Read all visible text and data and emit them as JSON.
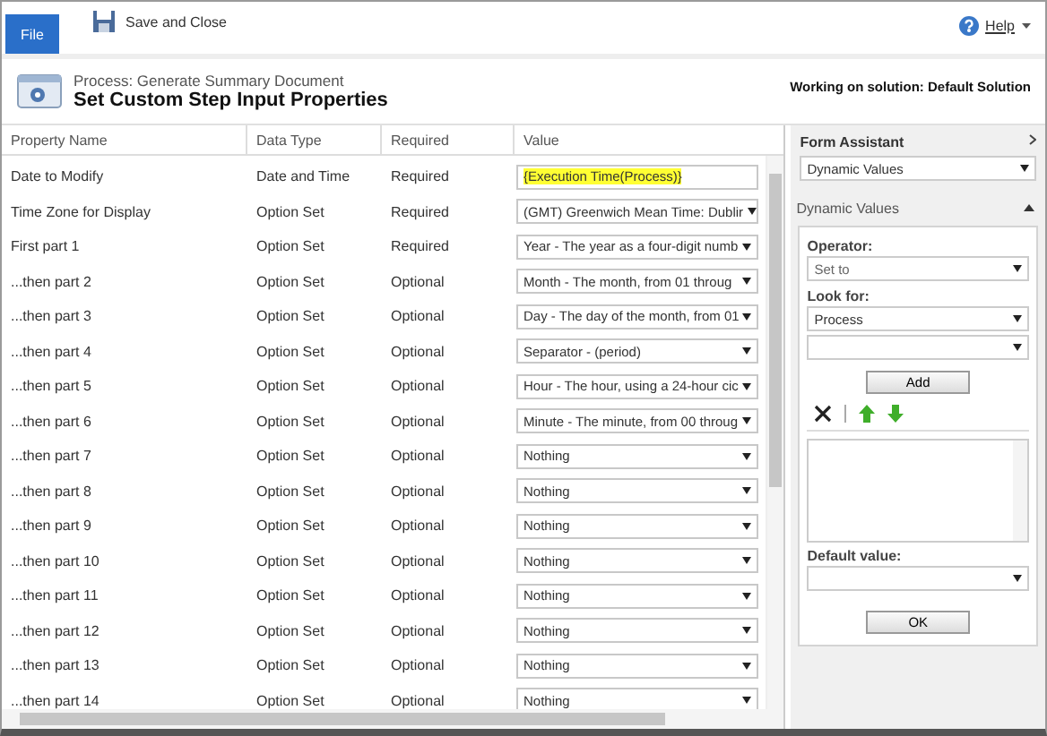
{
  "ribbon": {
    "file_tab": "File",
    "save_close": "Save and Close",
    "help": "Help"
  },
  "header": {
    "breadcrumb": "Process: Generate Summary Document",
    "title": "Set Custom Step Input Properties",
    "solution": "Working on solution: Default Solution"
  },
  "table": {
    "columns": [
      "Property Name",
      "Data Type",
      "Required",
      "Value"
    ],
    "rows": [
      {
        "name": "Date to Modify",
        "type": "Date and Time",
        "required": "Required",
        "kind": "text",
        "value": "{Execution Time(Process)}",
        "highlighted": true
      },
      {
        "name": "Time Zone for Display",
        "type": "Option Set",
        "required": "Required",
        "kind": "select",
        "value": "(GMT) Greenwich Mean Time: Dublir"
      },
      {
        "name": "First part 1",
        "type": "Option Set",
        "required": "Required",
        "kind": "select",
        "value": "Year - The year as a four-digit numb"
      },
      {
        "name": "...then part 2",
        "type": "Option Set",
        "required": "Optional",
        "kind": "select",
        "value": "Month - The month, from 01 throug"
      },
      {
        "name": "...then part 3",
        "type": "Option Set",
        "required": "Optional",
        "kind": "select",
        "value": "Day - The day of the month, from 01"
      },
      {
        "name": "...then part 4",
        "type": "Option Set",
        "required": "Optional",
        "kind": "select",
        "value": "Separator - (period)"
      },
      {
        "name": "...then part 5",
        "type": "Option Set",
        "required": "Optional",
        "kind": "select",
        "value": "Hour - The hour, using a 24-hour cic"
      },
      {
        "name": "...then part 6",
        "type": "Option Set",
        "required": "Optional",
        "kind": "select",
        "value": "Minute - The minute, from 00 throug"
      },
      {
        "name": "...then part 7",
        "type": "Option Set",
        "required": "Optional",
        "kind": "select",
        "value": "Nothing"
      },
      {
        "name": "...then part 8",
        "type": "Option Set",
        "required": "Optional",
        "kind": "select",
        "value": "Nothing"
      },
      {
        "name": "...then part 9",
        "type": "Option Set",
        "required": "Optional",
        "kind": "select",
        "value": "Nothing"
      },
      {
        "name": "...then part 10",
        "type": "Option Set",
        "required": "Optional",
        "kind": "select",
        "value": "Nothing"
      },
      {
        "name": "...then part 11",
        "type": "Option Set",
        "required": "Optional",
        "kind": "select",
        "value": "Nothing"
      },
      {
        "name": "...then part 12",
        "type": "Option Set",
        "required": "Optional",
        "kind": "select",
        "value": "Nothing"
      },
      {
        "name": "...then part 13",
        "type": "Option Set",
        "required": "Optional",
        "kind": "select",
        "value": "Nothing"
      },
      {
        "name": "...then part 14",
        "type": "Option Set",
        "required": "Optional",
        "kind": "select",
        "value": "Nothing"
      }
    ]
  },
  "form_assistant": {
    "title": "Form Assistant",
    "mode": "Dynamic Values",
    "section": "Dynamic Values",
    "expanded": true,
    "operator_label": "Operator:",
    "operator": "Set to",
    "look_for_label": "Look for:",
    "look_for": "Process",
    "add": "Add",
    "default_label": "Default value:",
    "ok": "OK"
  }
}
